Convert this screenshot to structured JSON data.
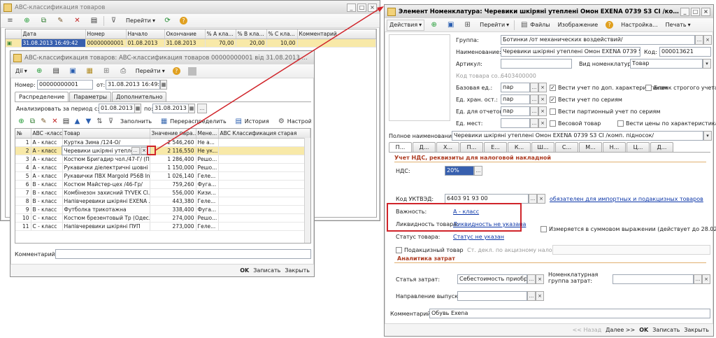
{
  "bg_window": {
    "title": "ABC-классификация товаров",
    "toolbar": {
      "go": "Перейти"
    },
    "columns": [
      "",
      "Дата",
      "Номер",
      "Начало",
      "Окончание",
      "% А кла...",
      "% В кла...",
      "% С кла...",
      "Комментарий"
    ],
    "rows": [
      [
        "",
        "31.08.2013 16:49:42",
        "00000000001",
        "01.08.2013",
        "31.08.2013",
        "70,00",
        "20,00",
        "10,00",
        ""
      ]
    ]
  },
  "doc_window": {
    "title": "ABC-классификация товаров: ABC-классификация товаров 00000000001 від 31.08.2013 16:49:42",
    "toolbar": {
      "actions": "Дії",
      "go": "Перейти"
    },
    "number_label": "Номер:",
    "number_value": "00000000001",
    "date_label": "от:",
    "date_value": "31.08.2013 16:49:42",
    "tabs": [
      "Распределение",
      "Параметры",
      "Дополнительно"
    ],
    "period_label": "Анализировать за период с:",
    "period_from": "01.08.2013",
    "period_to_label": "по:",
    "period_to": "31.08.2013",
    "table_toolbar": {
      "fill": "Заполнить",
      "redistribute": "Перераспределить",
      "history": "История",
      "settings": "Настройки"
    },
    "columns": [
      "№",
      "ABC -класс",
      "Товар",
      "Значение пара...",
      "Мене...",
      "ABC Классификация старая"
    ],
    "rows": [
      [
        "1",
        "А - класс",
        "Куртка Зима /124-О/",
        "2 546,260",
        "Не а...",
        ""
      ],
      [
        "2",
        "А - класс",
        "Черевики шкіряні утеплені",
        "2 116,550",
        "Не ук...",
        ""
      ],
      [
        "3",
        "А - класс",
        "Костюм Бригадир чол./47-Г/ (П...",
        "1 286,400",
        "Решо...",
        ""
      ],
      [
        "4",
        "А - класс",
        "Рукавички діелектричні шовні гу...",
        "1 150,000",
        "Решо...",
        ""
      ],
      [
        "5",
        "А - класс",
        "Рукавички ПВХ Margold P56B In...",
        "1 026,140",
        "Гелe...",
        ""
      ],
      [
        "6",
        "B - класс",
        "Костюм Майстер-цех /46-Гр/",
        "759,260",
        "Фуга...",
        ""
      ],
      [
        "7",
        "B - класс",
        "Комбінезон захисний TYVEK Cl...",
        "556,000",
        "Кизи...",
        ""
      ],
      [
        "8",
        "B - класс",
        "Напівчеревики шкіряні EXENA ...",
        "443,380",
        "Гелe...",
        ""
      ],
      [
        "9",
        "B - класс",
        "Футболка трикотажна",
        "338,400",
        "Фуга...",
        ""
      ],
      [
        "10",
        "C - класс",
        "Костюм брезентовый Тр (Одес...",
        "274,000",
        "Решо...",
        ""
      ],
      [
        "11",
        "C - класс",
        "Напівчеревики шкіряні ПУП",
        "273,000",
        "Гелe...",
        ""
      ]
    ],
    "comment_label": "Комментарий:",
    "footer": {
      "ok": "OK",
      "save": "Записать",
      "close": "Закрыть"
    }
  },
  "item_window": {
    "title": "Элемент Номенклатура: Черевики шкіряні утеплені Омон EXENA 0739 S3 CI /комп. підносок/",
    "toolbar": {
      "actions": "Действия",
      "go": "Перейти",
      "files": "Файлы",
      "image": "Изображение",
      "settings": "Настройка...",
      "print": "Печать"
    },
    "group_label": "Группа:",
    "group_value": "Ботинки /от механических воздействий/",
    "name_label": "Наименование:",
    "name_value": "Черевики шкіряні утеплені Омон EXENA 0739 S3 CI /ко",
    "code_label": "Код:",
    "code_value": "000013621",
    "article_label": "Артикул:",
    "kind_label": "Вид номенклатуры:",
    "kind_value": "Товар",
    "product_code_label": "Код товара со...",
    "product_code_value": "6403400000",
    "base_unit_label": "Базовая ед.:",
    "base_unit_value": "пар",
    "storage_unit_label": "Ед. хран. ост.:",
    "storage_unit_value": "пар",
    "report_unit_label": "Ед. для отчетов:",
    "report_unit_value": "пар",
    "place_unit_label": "Ед. мест:",
    "chk_chars": "Вести учет по доп. характеристикам",
    "chk_strict": "Бланк строгого учета",
    "chk_series": "Вести учет по сериям",
    "chk_batch": "Вести партионный учет по сериям",
    "chk_weight": "Весовой товар",
    "chk_prices": "Вести цены по характеристикам",
    "full_name_label": "Полное наименование:",
    "full_name_value": "Черевики шкіряні утеплені Омон EXENA 0739 S3 CI /комп. підносок/",
    "tabs": [
      "П...",
      "Д...",
      "Х...",
      "П...",
      "Е...",
      "К...",
      "Ш...",
      "С...",
      "М...",
      "Н...",
      "Ц...",
      "Д..."
    ],
    "vat_section": "Учет НДС, реквизиты для налоговой накладной",
    "vat_label": "НДС:",
    "vat_value": "20%",
    "uktved_label": "Код УКТВЭД:",
    "uktved_value": "6403 91 93 00",
    "uktved_link": "обязателен для импортных и подакцизных товаров",
    "importance_label": "Важность:",
    "importance_value": "А - класс",
    "liquidity_label": "Ликвидность товара:",
    "liquidity_value": "Ликвидность не указана",
    "status_label": "Статус товара:",
    "status_value": "Статус не указан",
    "chk_sum": "Измеряется в суммовом выражении (действует до 28.02.20...",
    "chk_excise": "Подакцизный товар",
    "excise_label": "Ст. декл. по акцизному налогу:",
    "cost_section": "Аналитика затрат",
    "cost_item_label": "Статья затрат:",
    "cost_item_value": "Себестоимость приобрете",
    "nom_group_label": "Номенклатурная группа затрат:",
    "release_label": "Направление выпуска:",
    "comment_label": "Комментарий:",
    "comment_value": "Обувь Exena",
    "footer": {
      "back": "<< Назад",
      "next": "Далее >>",
      "ok": "OK",
      "save": "Записать",
      "close": "Закрыть"
    }
  }
}
